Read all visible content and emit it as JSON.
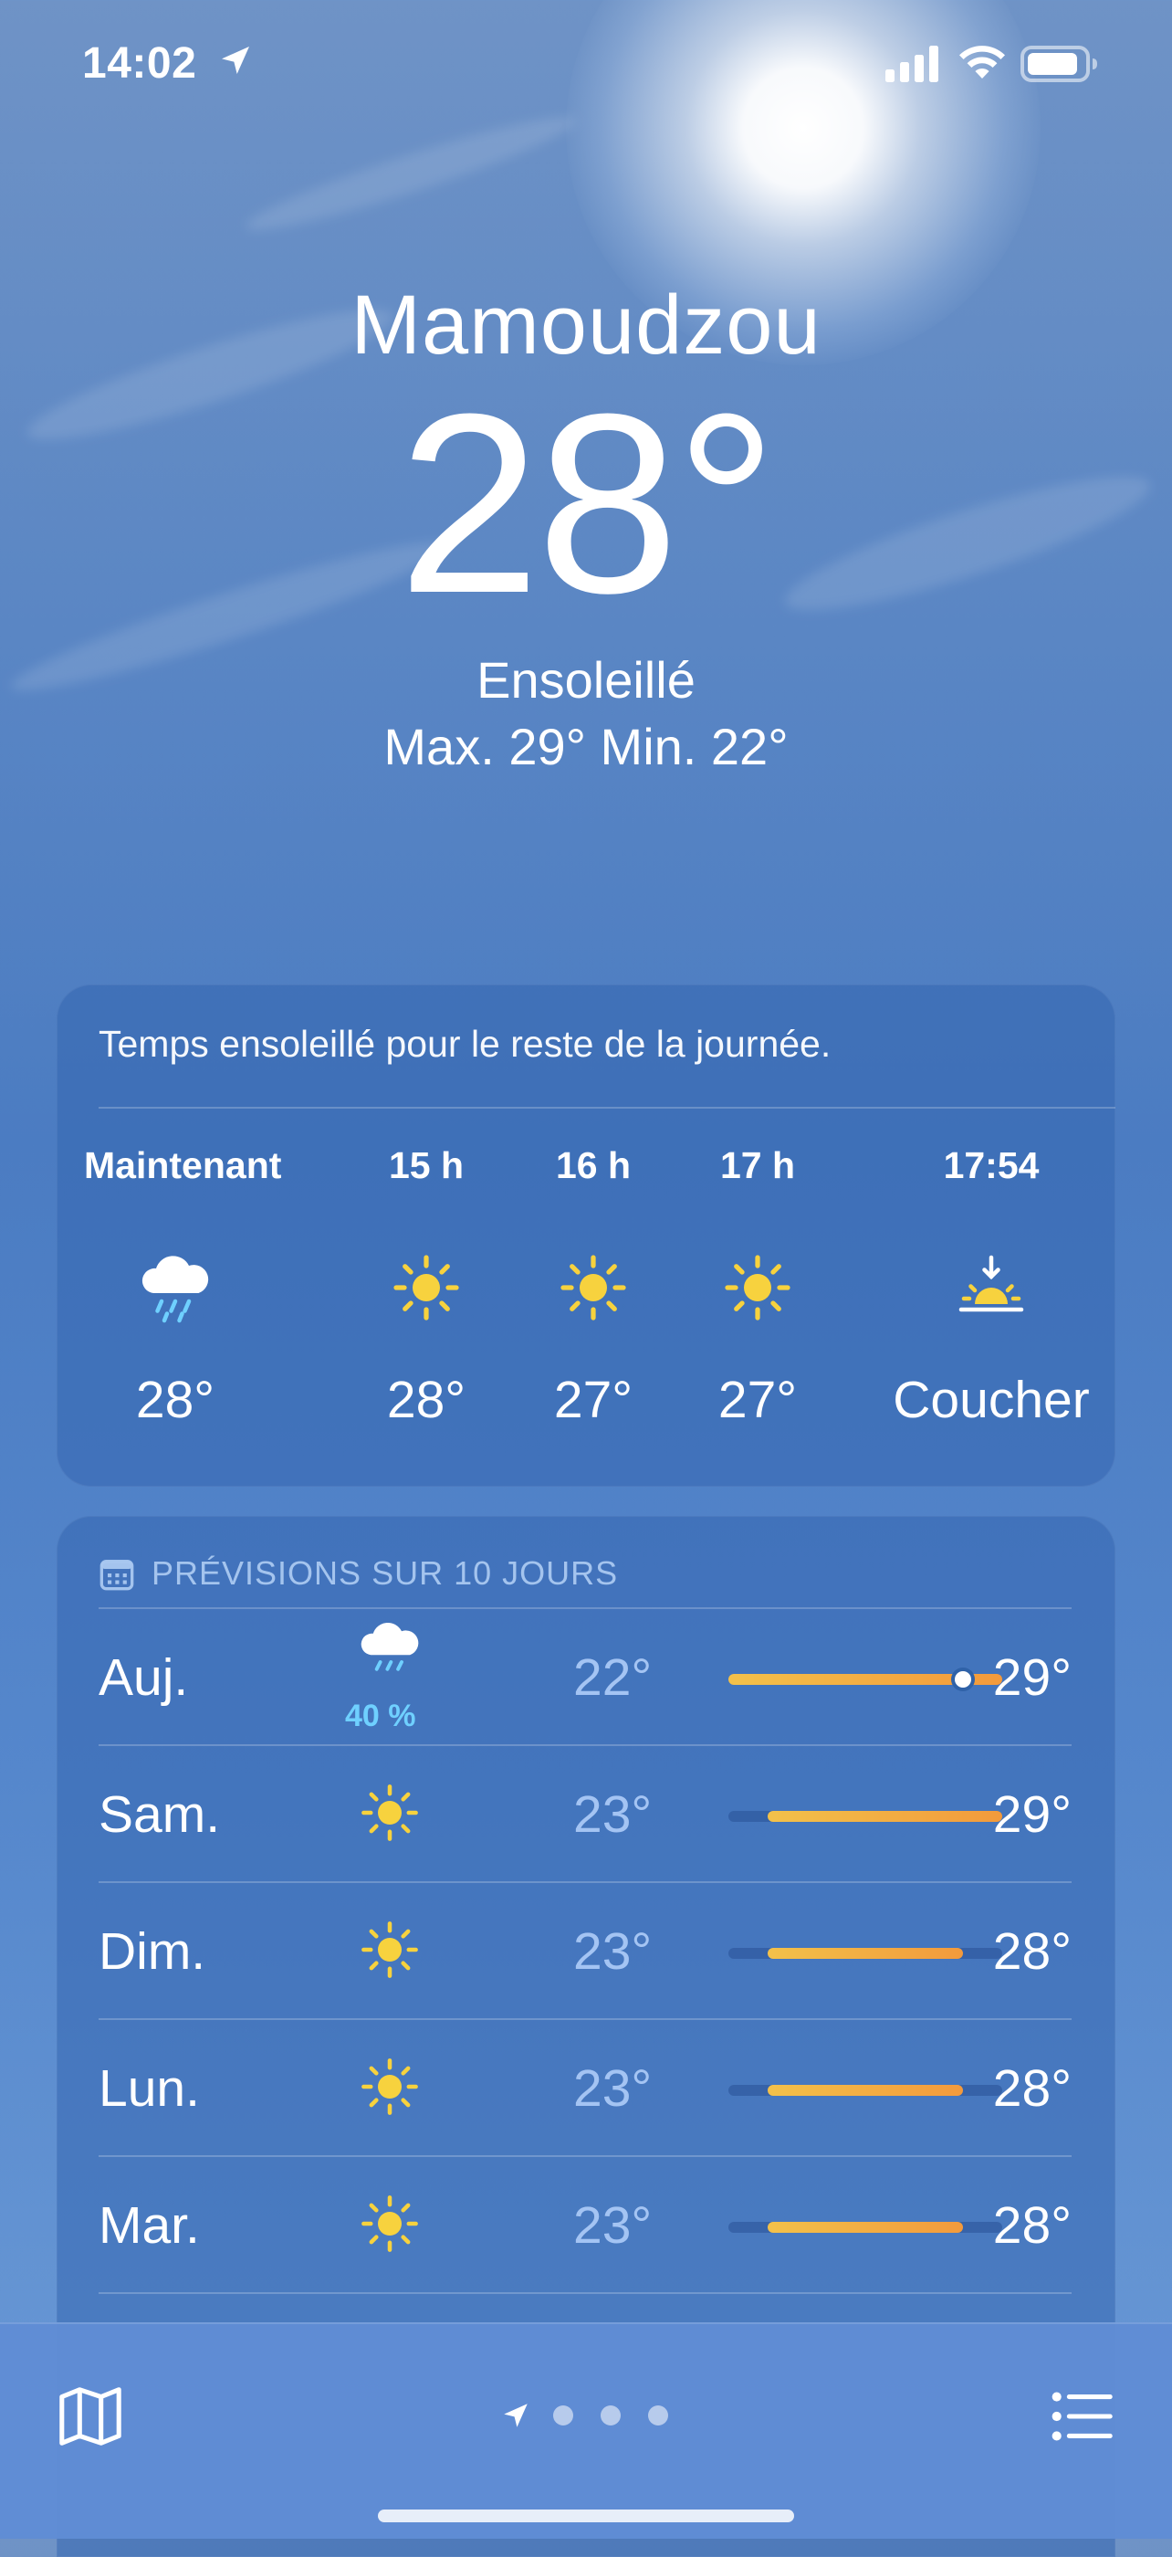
{
  "status_bar": {
    "time": "14:02"
  },
  "location": {
    "city": "Mamoudzou",
    "temperature": "28°",
    "condition": "Ensoleillé",
    "high_low": "Max. 29°  Min. 22°"
  },
  "hourly": {
    "summary": "Temps ensoleillé pour le reste de la journée.",
    "items": [
      {
        "label": "Maintenant",
        "icon": "cloud-rain-icon",
        "value": "28°"
      },
      {
        "label": "15 h",
        "icon": "sun-icon",
        "value": "28°"
      },
      {
        "label": "16 h",
        "icon": "sun-icon",
        "value": "27°"
      },
      {
        "label": "17 h",
        "icon": "sun-icon",
        "value": "27°"
      },
      {
        "label": "17:54",
        "icon": "sunset-icon",
        "value": "Coucher"
      }
    ]
  },
  "daily": {
    "title": "PRÉVISIONS SUR 10 JOURS",
    "range_min": 22,
    "range_max": 29,
    "days": [
      {
        "day": "Auj.",
        "icon": "cloud-rain-icon",
        "precip": "40 %",
        "low": "22°",
        "high": "29°",
        "low_val": 22,
        "high_val": 29,
        "current_val": 28
      },
      {
        "day": "Sam.",
        "icon": "sun-icon",
        "precip": "",
        "low": "23°",
        "high": "29°",
        "low_val": 23,
        "high_val": 29
      },
      {
        "day": "Dim.",
        "icon": "sun-icon",
        "precip": "",
        "low": "23°",
        "high": "28°",
        "low_val": 23,
        "high_val": 28
      },
      {
        "day": "Lun.",
        "icon": "sun-icon",
        "precip": "",
        "low": "23°",
        "high": "28°",
        "low_val": 23,
        "high_val": 28
      },
      {
        "day": "Mar.",
        "icon": "sun-icon",
        "precip": "",
        "low": "23°",
        "high": "28°",
        "low_val": 23,
        "high_val": 28
      }
    ]
  },
  "tab_bar": {
    "left_icon": "map-icon",
    "page_count": 3,
    "right_icon": "list-icon"
  },
  "colors": {
    "accent_bar_start": "#f3c14a",
    "accent_bar_end": "#f39a3c",
    "precip_text": "#6fd0ff",
    "sun_yellow": "#f7d23e"
  }
}
